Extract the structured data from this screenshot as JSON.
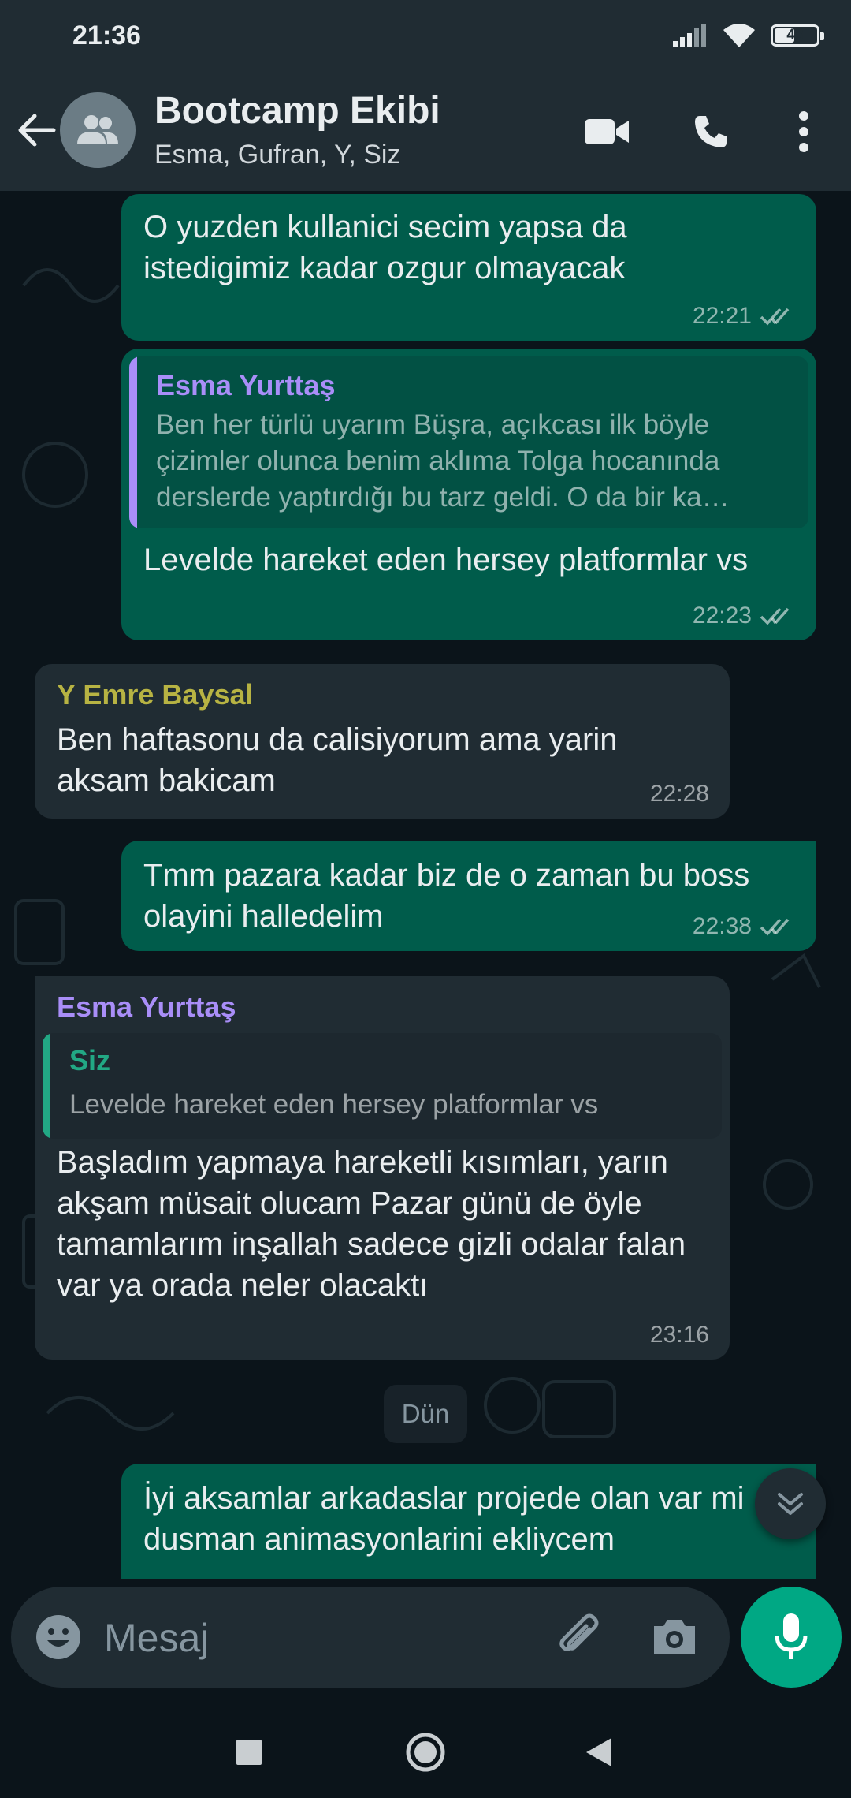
{
  "status_bar": {
    "time": "21:36",
    "battery": "48",
    "battery_level": 0.48
  },
  "header": {
    "title": "Bootcamp Ekibi",
    "subtitle": "Esma, Gufran, Y, Siz"
  },
  "colors": {
    "outgoing": "#005c4b",
    "incoming": "#202c33",
    "accent": "#00a884",
    "esma": "#a98ef8",
    "emre": "#b7b343",
    "siz": "#22a884"
  },
  "messages": [
    {
      "type": "outgoing",
      "text": "O yuzden kullanici secim yapsa da istedigimiz kadar ozgur olmayacak",
      "time": "22:21",
      "status": "read"
    },
    {
      "type": "outgoing",
      "quote": {
        "sender": "Esma Yurttaş",
        "text": "Ben her türlü uyarım Büşra, açıkcası ilk böyle çizimler olunca benim aklıma Tolga hocanında derslerde yaptırdığı bu tarz geldi. O da bir ka…"
      },
      "text": "Levelde hareket eden hersey platformlar vs",
      "time": "22:23",
      "status": "read"
    },
    {
      "type": "incoming",
      "sender": "Y Emre Baysal",
      "text": "Ben haftasonu da calisiyorum ama yarin aksam bakicam",
      "time": "22:28"
    },
    {
      "type": "outgoing",
      "text": "Tmm pazara kadar biz de o zaman bu boss olayini halledelim",
      "time": "22:38",
      "status": "read"
    },
    {
      "type": "incoming",
      "sender": "Esma Yurttaş",
      "quote": {
        "sender": "Siz",
        "text": "Levelde hareket eden hersey platformlar vs"
      },
      "text": "Başladım yapmaya hareketli kısımları, yarın akşam müsait olucam  Pazar günü de öyle tamamlarım inşallah  sadece gizli odalar falan var ya orada neler olacaktı",
      "time": "23:16"
    },
    {
      "type": "date",
      "text": "Dün"
    },
    {
      "type": "outgoing",
      "text": "İyi aksamlar arkadaslar projede olan var mi dusman animasyonlarini ekliycem"
    }
  ],
  "composer": {
    "placeholder": "Mesaj"
  }
}
